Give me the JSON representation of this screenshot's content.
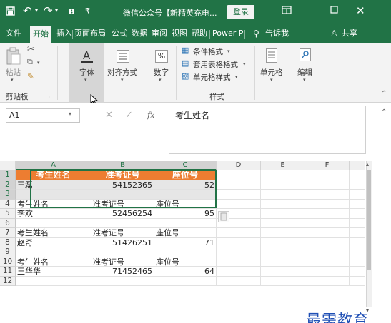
{
  "titlebar": {
    "title": "微信公众号【新精英充电...",
    "login": "登录",
    "bold_label": "B",
    "customize_label": "₹"
  },
  "tabs": [
    "文件",
    "开始",
    "插入",
    "页面布局",
    "公式",
    "数据",
    "审阅",
    "视图",
    "帮助",
    "Power P",
    "告诉我",
    "共享"
  ],
  "ribbon": {
    "paste": "粘贴",
    "clipboard": "剪贴板",
    "font": "字体",
    "alignment": "对齐方式",
    "number": "数字",
    "percent": "%",
    "conditional_format": "条件格式",
    "format_table": "套用表格格式",
    "cell_style": "单元格样式",
    "styles": "样式",
    "cells": "单元格",
    "editing": "编辑"
  },
  "formula_bar": {
    "name_box": "A1",
    "fx": "fx",
    "content": "考生姓名"
  },
  "columns": [
    "A",
    "B",
    "C",
    "D",
    "E",
    "F"
  ],
  "rows": [
    {
      "n": "1",
      "a": "考生姓名",
      "b": "准考证号",
      "c": "座位号"
    },
    {
      "n": "2",
      "a": "王磊",
      "b": "54152365",
      "c": "52"
    },
    {
      "n": "3",
      "a": "",
      "b": "",
      "c": ""
    },
    {
      "n": "4",
      "a": "考生姓名",
      "b": "准考证号",
      "c": "座位号"
    },
    {
      "n": "5",
      "a": "李欢",
      "b": "52456254",
      "c": "95"
    },
    {
      "n": "6",
      "a": "",
      "b": "",
      "c": ""
    },
    {
      "n": "7",
      "a": "考生姓名",
      "b": "准考证号",
      "c": "座位号"
    },
    {
      "n": "8",
      "a": "赵奇",
      "b": "51426251",
      "c": "71"
    },
    {
      "n": "9",
      "a": "",
      "b": "",
      "c": ""
    },
    {
      "n": "10",
      "a": "考生姓名",
      "b": "准考证号",
      "c": "座位号"
    },
    {
      "n": "11",
      "a": "王华华",
      "b": "71452465",
      "c": "64"
    },
    {
      "n": "12",
      "a": "",
      "b": "",
      "c": ""
    }
  ],
  "watermark": "最需教育",
  "colors": {
    "excel_green": "#217346",
    "header_orange": "#ed7d31",
    "watermark_blue": "#1f4fb5"
  }
}
